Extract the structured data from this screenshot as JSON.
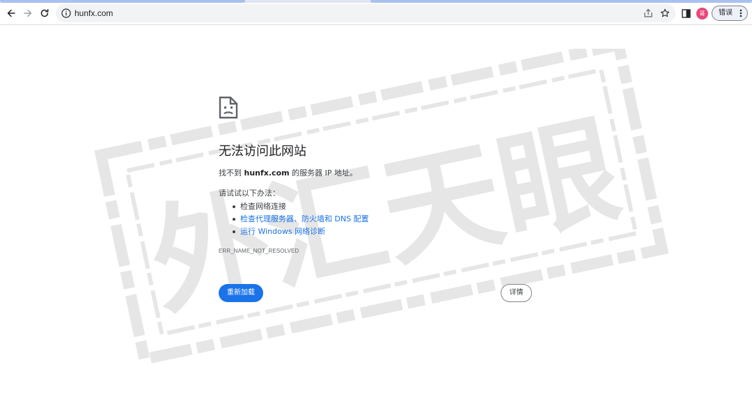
{
  "browser": {
    "url": "hunfx.com",
    "profile_initial": "哥",
    "error_button_label": "错误"
  },
  "error_page": {
    "title": "无法访问此网站",
    "description_prefix": "找不到",
    "domain": "hunfx.com",
    "description_suffix": "的服务器 IP 地址。",
    "try_label": "请试试以下办法：",
    "suggestions": [
      "检查网络连接",
      "检查代理服务器、防火墙和 DNS 配置",
      "运行 Windows 网络诊断"
    ],
    "error_code": "ERR_NAME_NOT_RESOLVED",
    "reload_label": "重新加载",
    "details_label": "详情"
  },
  "colors": {
    "accent": "#1a73e8",
    "link": "#1a73e8",
    "profile": "#e8477a",
    "watermark": "#bfbfbf"
  },
  "watermark": {
    "text": "外汇天眼"
  }
}
